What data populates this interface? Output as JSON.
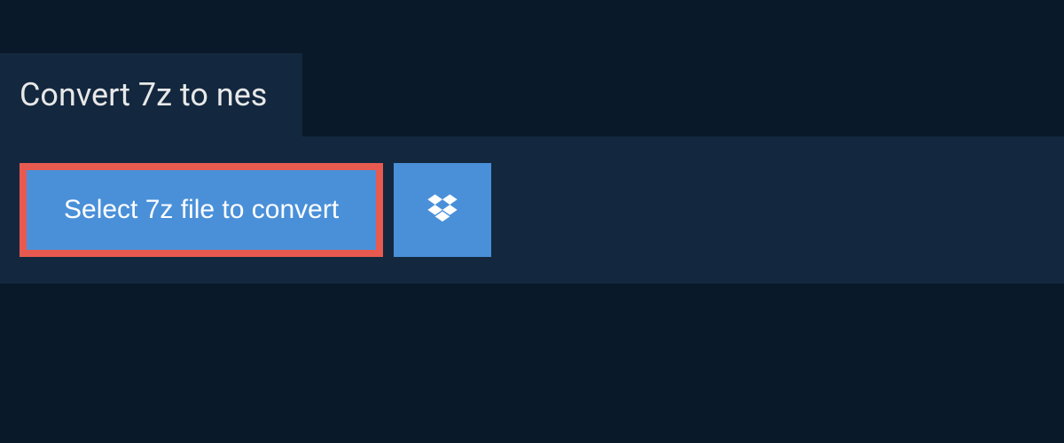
{
  "tab": {
    "title": "Convert 7z to nes"
  },
  "actions": {
    "select_file_label": "Select 7z file to convert"
  },
  "colors": {
    "page_bg": "#0a1929",
    "panel_bg": "#13283f",
    "button_bg": "#4a90d9",
    "highlight_border": "#e85a4f",
    "text_light": "#e8e8e8",
    "text_white": "#ffffff"
  }
}
